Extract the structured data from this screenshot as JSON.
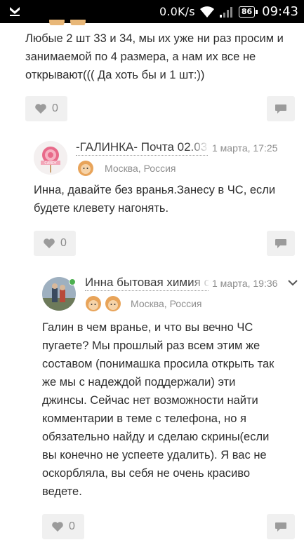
{
  "status_bar": {
    "speed": "0.0K/s",
    "battery": "86",
    "time": "09:43"
  },
  "comments": [
    {
      "text_lines": [
        "Любые 2 шт 33 и 34, мы их уже ни раз просим и",
        "занимаемой по 4 размера, а нам их все не",
        "открывают((( Да хоть бы и 1 шт:))"
      ],
      "likes": "0"
    },
    {
      "author": "-ГАЛИНКА- Почта 02.03",
      "date": "1 марта, 17:25",
      "location": "Москва, Россия",
      "avatar_text": "CANDY",
      "text_lines": [
        "Инна, давайте  без вранья.Занесу в ЧС, если",
        "будете клевету  нагонять."
      ],
      "likes": "0"
    },
    {
      "author": "Инна бытовая химия с",
      "date": "1 марта, 19:36",
      "location": "Москва, Россия",
      "text_lines": [
        "Галин в чем вранье, и что вы вечно ЧС",
        "пугаете? Мы прошлый раз всем этим же",
        "составом (понимашка просила открыть так",
        "же мы с надеждой поддержали) эти",
        "джинсы. Сейчас нет возможности найти",
        "комментарии в теме с телефона, но я",
        "обязательно найду и сделаю скрины(если",
        "вы конечно не успеете удалить). Я вас не",
        "оскорбляла, вы себя не очень красиво",
        "ведете."
      ],
      "likes": "0"
    }
  ],
  "colors": {
    "button_bg": "#f0f0f0",
    "icon_gray": "#9b9b9b",
    "meta_gray": "#8e8e8e",
    "online_green": "#4caf50"
  }
}
